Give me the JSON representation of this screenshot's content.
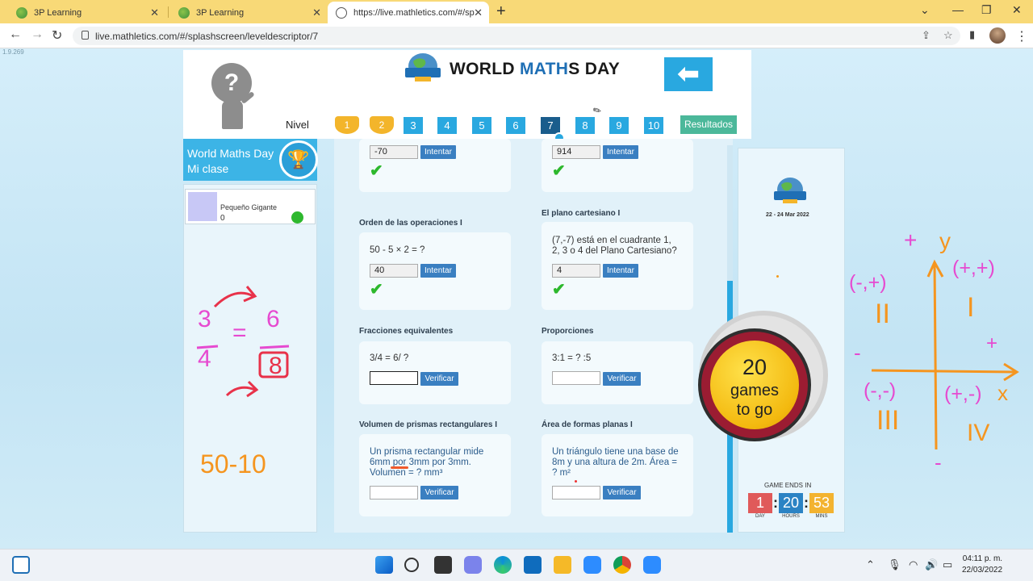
{
  "browser": {
    "tabs": [
      {
        "title": "3P Learning",
        "active": false
      },
      {
        "title": "3P Learning",
        "active": false
      },
      {
        "title": "https://live.mathletics.com/#/spla",
        "active": true
      }
    ],
    "url": "live.mathletics.com/#/splashscreen/leveldescriptor/7",
    "version_hint": "1.9.269"
  },
  "header": {
    "logo_text": "WORLD MATHS DAY",
    "title_part1": "WORLD ",
    "title_part2": "MATH",
    "title_part3": "S DAY",
    "nivel_label": "Nivel",
    "levels": [
      "1",
      "2",
      "3",
      "4",
      "5",
      "6",
      "7",
      "8",
      "9",
      "10"
    ],
    "selected_level": "7",
    "resultados_label": "Resultados"
  },
  "class_panel": {
    "line1": "World Maths Day",
    "line2": "Mi clase",
    "student": {
      "name": "Pequeño Gigante",
      "score": "0"
    }
  },
  "questions": [
    {
      "title": "",
      "text": "",
      "answer": "-70",
      "button": "Intentar",
      "correct": true
    },
    {
      "title": "",
      "text": "",
      "answer": "914",
      "button": "Intentar",
      "correct": true
    },
    {
      "title": "Orden de las operaciones I",
      "text": "50 - 5 × 2 = ?",
      "answer": "40",
      "button": "Intentar",
      "correct": true
    },
    {
      "title": "El plano cartesiano I",
      "text_lines": [
        "(7,-7) está en el cuadrante 1,",
        "2, 3 o 4 del Plano Cartesiano?"
      ],
      "answer": "4",
      "button": "Intentar",
      "correct": true
    },
    {
      "title": "Fracciones equivalentes",
      "text": "3/4 = 6/ ?",
      "answer": "",
      "button": "Verificar",
      "correct": false
    },
    {
      "title": "Proporciones",
      "text": "3:1 = ? :5",
      "answer": "",
      "button": "Verificar",
      "correct": false
    },
    {
      "title": "Volumen de prismas rectangulares I",
      "text_lines": [
        "Un prisma rectangular mide",
        "6mm por 3mm por 3mm.",
        "Volumen = ? mm³"
      ],
      "answer": "",
      "button": "Verificar",
      "correct": false
    },
    {
      "title": "Área de formas planas I",
      "text_lines": [
        "Un triángulo tiene una base de",
        "8m y una altura de 2m. Área =",
        "? m²"
      ],
      "answer": "",
      "button": "Verificar",
      "correct": false
    }
  ],
  "info": {
    "dates": "22 - 24 Mar 2022",
    "games_number": "20",
    "games_line1": "games",
    "games_line2": "to go",
    "game_ends_label": "GAME ENDS IN",
    "countdown": [
      {
        "value": "1",
        "label": "DAY",
        "color": "#e05a5a"
      },
      {
        "value": "20",
        "label": "HOURS",
        "color": "#2b83c4"
      },
      {
        "value": "53",
        "label": "MINS",
        "color": "#f3b330"
      }
    ]
  },
  "annotations": {
    "left_fraction": {
      "top_left": "3",
      "bottom_left": "4",
      "equals": "=",
      "top_right": "6",
      "bottom_right": "8"
    },
    "left_sum": "50-10",
    "cartesian": {
      "plus_top": "+",
      "y_label": "y",
      "x_label": "x",
      "q2_sign": "(-,+)",
      "q1_sign": "(+,+)",
      "q3_sign": "(-,-)",
      "q4_sign": "(+,-)",
      "q1": "I",
      "q2": "II",
      "q3": "III",
      "q4": "IV",
      "minus_left": "-",
      "plus_right": "+",
      "minus_bottom": "-"
    }
  },
  "taskbar": {
    "time": "04:11 p. m.",
    "date": "22/03/2022"
  },
  "colors": {
    "accent": "#29a8e0",
    "selected_level": "#1a5d8c",
    "resultados": "#4bb89a",
    "button": "#3a7fc1",
    "check": "#2db82d",
    "wheel_ring": "#9b1c32",
    "wheel_gold": "#f3b90f",
    "annotation_red": "#e8324a",
    "annotation_pink": "#e64ad0",
    "annotation_orange": "#f5951f"
  }
}
